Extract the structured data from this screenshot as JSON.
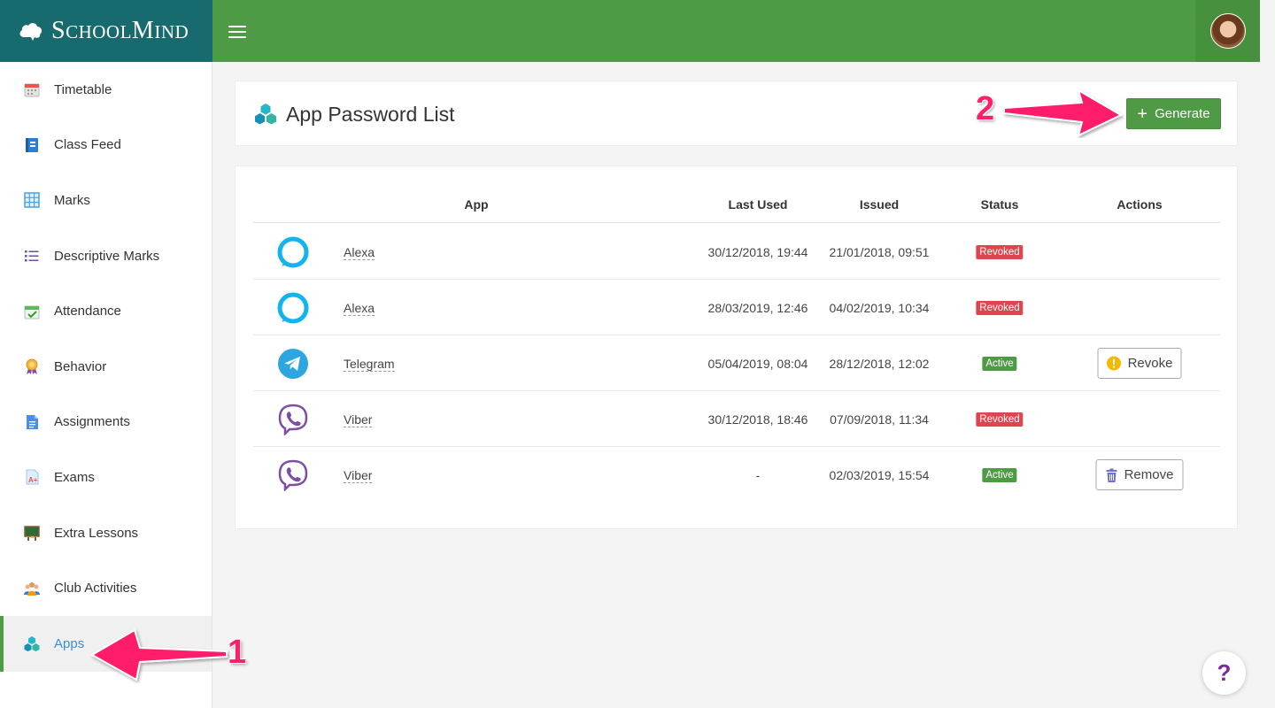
{
  "brand": {
    "name_first": "S",
    "name_rest_1": "CHOOL",
    "name_mid": "M",
    "name_rest_2": "IND"
  },
  "sidebar": {
    "items": [
      {
        "label": "Timetable",
        "icon": "calendar-icon"
      },
      {
        "label": "Class Feed",
        "icon": "feed-book-icon"
      },
      {
        "label": "Marks",
        "icon": "grid-icon"
      },
      {
        "label": "Descriptive Marks",
        "icon": "list-icon"
      },
      {
        "label": "Attendance",
        "icon": "calendar-check-icon"
      },
      {
        "label": "Behavior",
        "icon": "medal-icon"
      },
      {
        "label": "Assignments",
        "icon": "document-icon"
      },
      {
        "label": "Exams",
        "icon": "exam-grade-icon"
      },
      {
        "label": "Extra Lessons",
        "icon": "blackboard-icon"
      },
      {
        "label": "Club Activities",
        "icon": "group-icon"
      },
      {
        "label": "Apps",
        "icon": "apps-cubes-icon",
        "active": true
      }
    ]
  },
  "header": {
    "title": "App Password List",
    "generate_label": "Generate"
  },
  "table": {
    "columns": [
      "App",
      "Last Used",
      "Issued",
      "Status",
      "Actions"
    ],
    "rows": [
      {
        "app": "Alexa",
        "icon": "alexa-icon",
        "last_used": "30/12/2018, 19:44",
        "issued": "21/01/2018, 09:51",
        "status": "Revoked",
        "action": ""
      },
      {
        "app": "Alexa",
        "icon": "alexa-icon",
        "last_used": "28/03/2019, 12:46",
        "issued": "04/02/2019, 10:34",
        "status": "Revoked",
        "action": ""
      },
      {
        "app": "Telegram",
        "icon": "telegram-icon",
        "last_used": "05/04/2019, 08:04",
        "issued": "28/12/2018, 12:02",
        "status": "Active",
        "action": "Revoke"
      },
      {
        "app": "Viber",
        "icon": "viber-icon",
        "last_used": "30/12/2018, 18:46",
        "issued": "07/09/2018, 11:34",
        "status": "Revoked",
        "action": ""
      },
      {
        "app": "Viber",
        "icon": "viber-icon",
        "last_used": "-",
        "issued": "02/03/2019, 15:54",
        "status": "Active",
        "action": "Remove"
      }
    ]
  },
  "annotations": {
    "one": "1",
    "two": "2"
  },
  "help": {
    "label": "?"
  },
  "colors": {
    "topbar": "#4f9a45",
    "brand": "#176a6e",
    "revoked": "#e0454f",
    "active": "#4f9a45",
    "arrow": "#ff1f6a"
  }
}
